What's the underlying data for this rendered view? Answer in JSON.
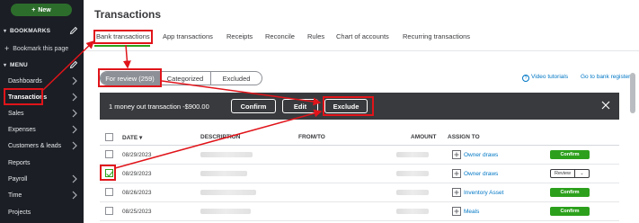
{
  "sidebar": {
    "new_label": "New",
    "bookmarks_label": "BOOKMARKS",
    "bookmark_this_page": "Bookmark this page",
    "menu_label": "MENU",
    "items": [
      {
        "label": "Dashboards"
      },
      {
        "label": "Transactions"
      },
      {
        "label": "Sales"
      },
      {
        "label": "Expenses"
      },
      {
        "label": "Customers & leads"
      },
      {
        "label": "Reports"
      },
      {
        "label": "Payroll"
      },
      {
        "label": "Time"
      },
      {
        "label": "Projects"
      }
    ]
  },
  "header": {
    "title": "Transactions"
  },
  "tabs": [
    {
      "label": "Bank transactions"
    },
    {
      "label": "App transactions"
    },
    {
      "label": "Receipts"
    },
    {
      "label": "Reconcile"
    },
    {
      "label": "Rules"
    },
    {
      "label": "Chart of accounts"
    },
    {
      "label": "Recurring transactions"
    }
  ],
  "filter_tabs": [
    {
      "label": "For review (259)"
    },
    {
      "label": "Categorized"
    },
    {
      "label": "Excluded"
    }
  ],
  "links": {
    "video_tutorials": "Video tutorials",
    "go_to_bank_register": "Go to bank register"
  },
  "action_bar": {
    "message": "1 money out transaction -$900.00",
    "confirm": "Confirm",
    "edit": "Edit",
    "exclude": "Exclude"
  },
  "table": {
    "columns": {
      "date": "DATE",
      "description": "DESCRIPTION",
      "from_to": "FROM/TO",
      "amount": "AMOUNT",
      "assign_to": "ASSIGN TO"
    },
    "rows": [
      {
        "date": "08/29/2023",
        "account": "Owner draws",
        "action": "Confirm",
        "checked": false
      },
      {
        "date": "08/29/2023",
        "account": "Owner draws",
        "action": "Review",
        "checked": true
      },
      {
        "date": "08/26/2023",
        "account": "Inventory Asset",
        "action": "Confirm",
        "checked": false
      },
      {
        "date": "08/25/2023",
        "account": "Meals",
        "action": "Confirm",
        "checked": false
      }
    ]
  },
  "colors": {
    "sidebar_bg": "#1b1e24",
    "accent_green": "#2ca01c",
    "link_blue": "#0077c5",
    "annotation_red": "#e0141a",
    "action_bar_bg": "#393a3d"
  }
}
